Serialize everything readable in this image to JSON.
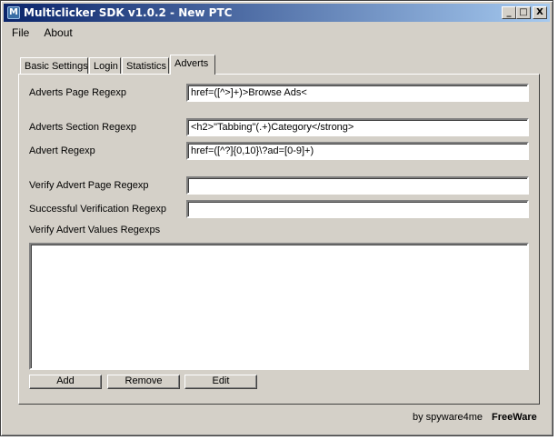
{
  "window": {
    "title": "Multiclicker SDK v1.0.2 - New PTC",
    "icon": "app-m-icon",
    "controls": {
      "minimize": "_",
      "maximize": "□",
      "close": "X"
    }
  },
  "menu": {
    "items": [
      "File",
      "About"
    ]
  },
  "tabs": [
    {
      "label": "Basic Settings",
      "active": false
    },
    {
      "label": "Login",
      "active": false
    },
    {
      "label": "Statistics",
      "active": false
    },
    {
      "label": "Adverts",
      "active": true
    }
  ],
  "form": {
    "adverts_page_regexp": {
      "label": "Adverts Page Regexp",
      "value": "href=([^>]+)>Browse Ads<"
    },
    "adverts_section_regexp": {
      "label": "Adverts Section Regexp",
      "value": "<h2>\"Tabbing\"(.+)Category</strong>"
    },
    "advert_regexp": {
      "label": "Advert Regexp",
      "value": "href=([^?]{0,10}\\?ad=[0-9]+)"
    },
    "verify_advert_page_regexp": {
      "label": "Verify Advert Page Regexp",
      "value": ""
    },
    "successful_verification_regexp": {
      "label": "Successful Verification Regexp",
      "value": ""
    },
    "verify_advert_values_regexps": {
      "label": "Verify Advert Values Regexps",
      "value": ""
    }
  },
  "buttons": {
    "add": "Add",
    "remove": "Remove",
    "edit": "Edit"
  },
  "footer": {
    "credit": "by spyware4me",
    "license": "FreeWare"
  }
}
